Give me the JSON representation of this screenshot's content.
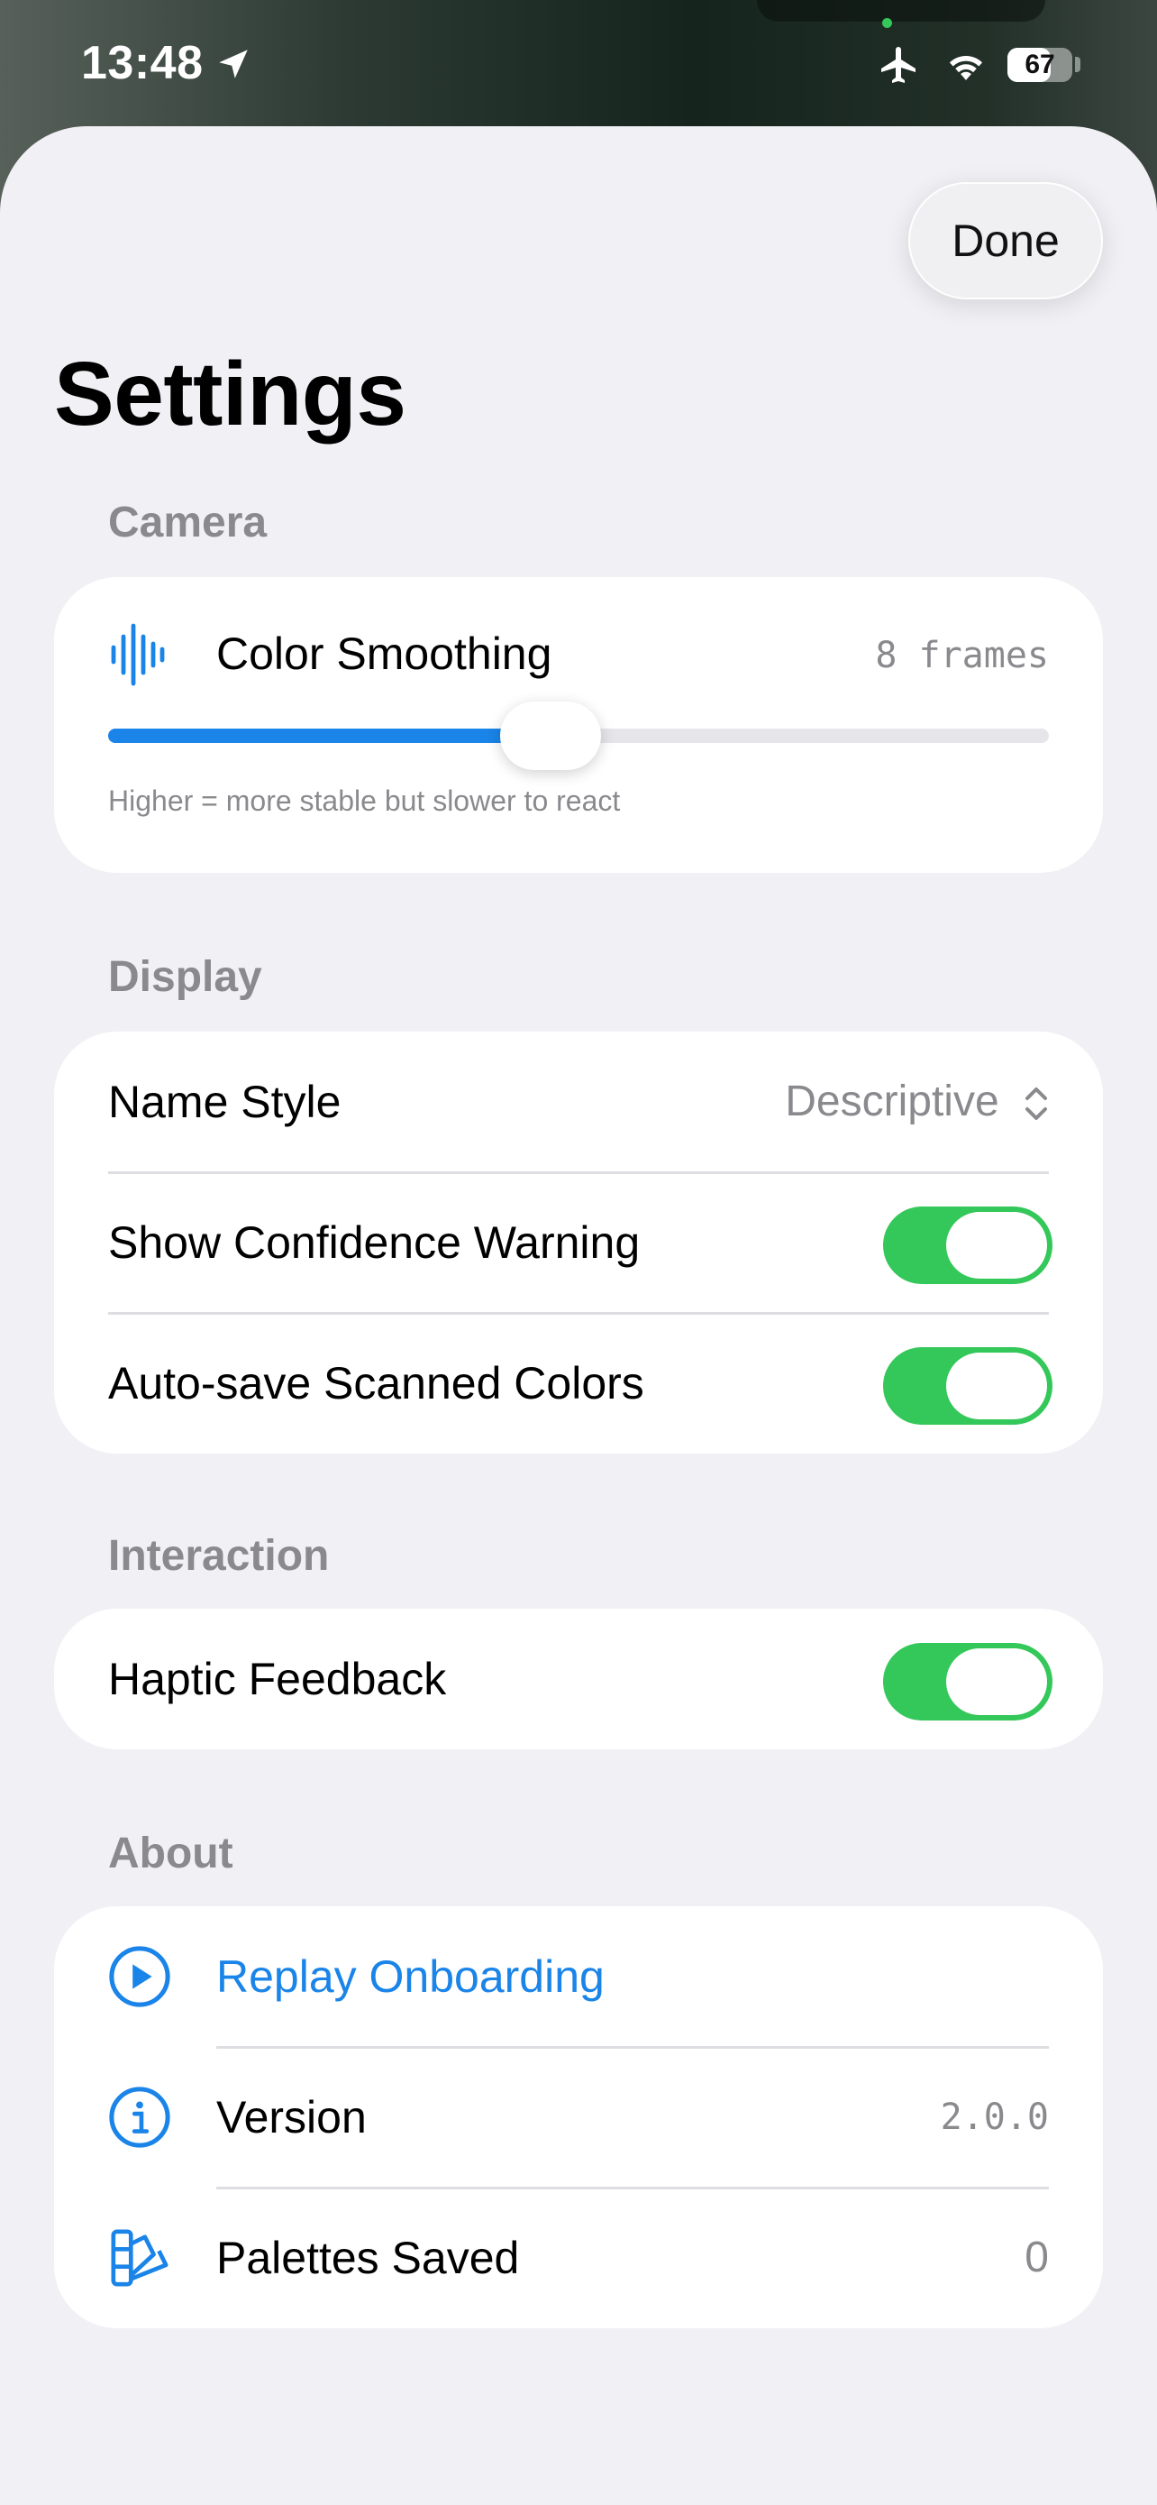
{
  "status_bar": {
    "time": "13:48",
    "battery_percent": 67,
    "battery_label": "67",
    "icons": [
      "location-arrow-icon",
      "airplane-icon",
      "wifi-icon",
      "battery-icon"
    ]
  },
  "header": {
    "done_label": "Done",
    "title": "Settings"
  },
  "sections": {
    "camera": {
      "header": "Camera",
      "color_smoothing": {
        "label": "Color Smoothing",
        "value": "8 frames",
        "slider_fraction": 0.47,
        "hint": "Higher = more stable but slower to react",
        "icon": "waveform-icon"
      }
    },
    "display": {
      "header": "Display",
      "name_style": {
        "label": "Name Style",
        "value": "Descriptive"
      },
      "confidence_warning": {
        "label": "Show Confidence Warning",
        "on": true
      },
      "auto_save": {
        "label": "Auto-save Scanned Colors",
        "on": true
      }
    },
    "interaction": {
      "header": "Interaction",
      "haptic": {
        "label": "Haptic Feedback",
        "on": true
      }
    },
    "about": {
      "header": "About",
      "replay": {
        "label": "Replay Onboarding",
        "icon": "play-circle-icon"
      },
      "version": {
        "label": "Version",
        "value": "2.0.0",
        "icon": "info-circle-icon"
      },
      "palettes": {
        "label": "Palettes Saved",
        "value": "0",
        "icon": "swatches-icon"
      }
    }
  },
  "colors": {
    "accent": "#1a84e8",
    "toggle_on": "#34c759",
    "background": "#f1f0f5",
    "secondary_text": "#8a8a8e"
  }
}
